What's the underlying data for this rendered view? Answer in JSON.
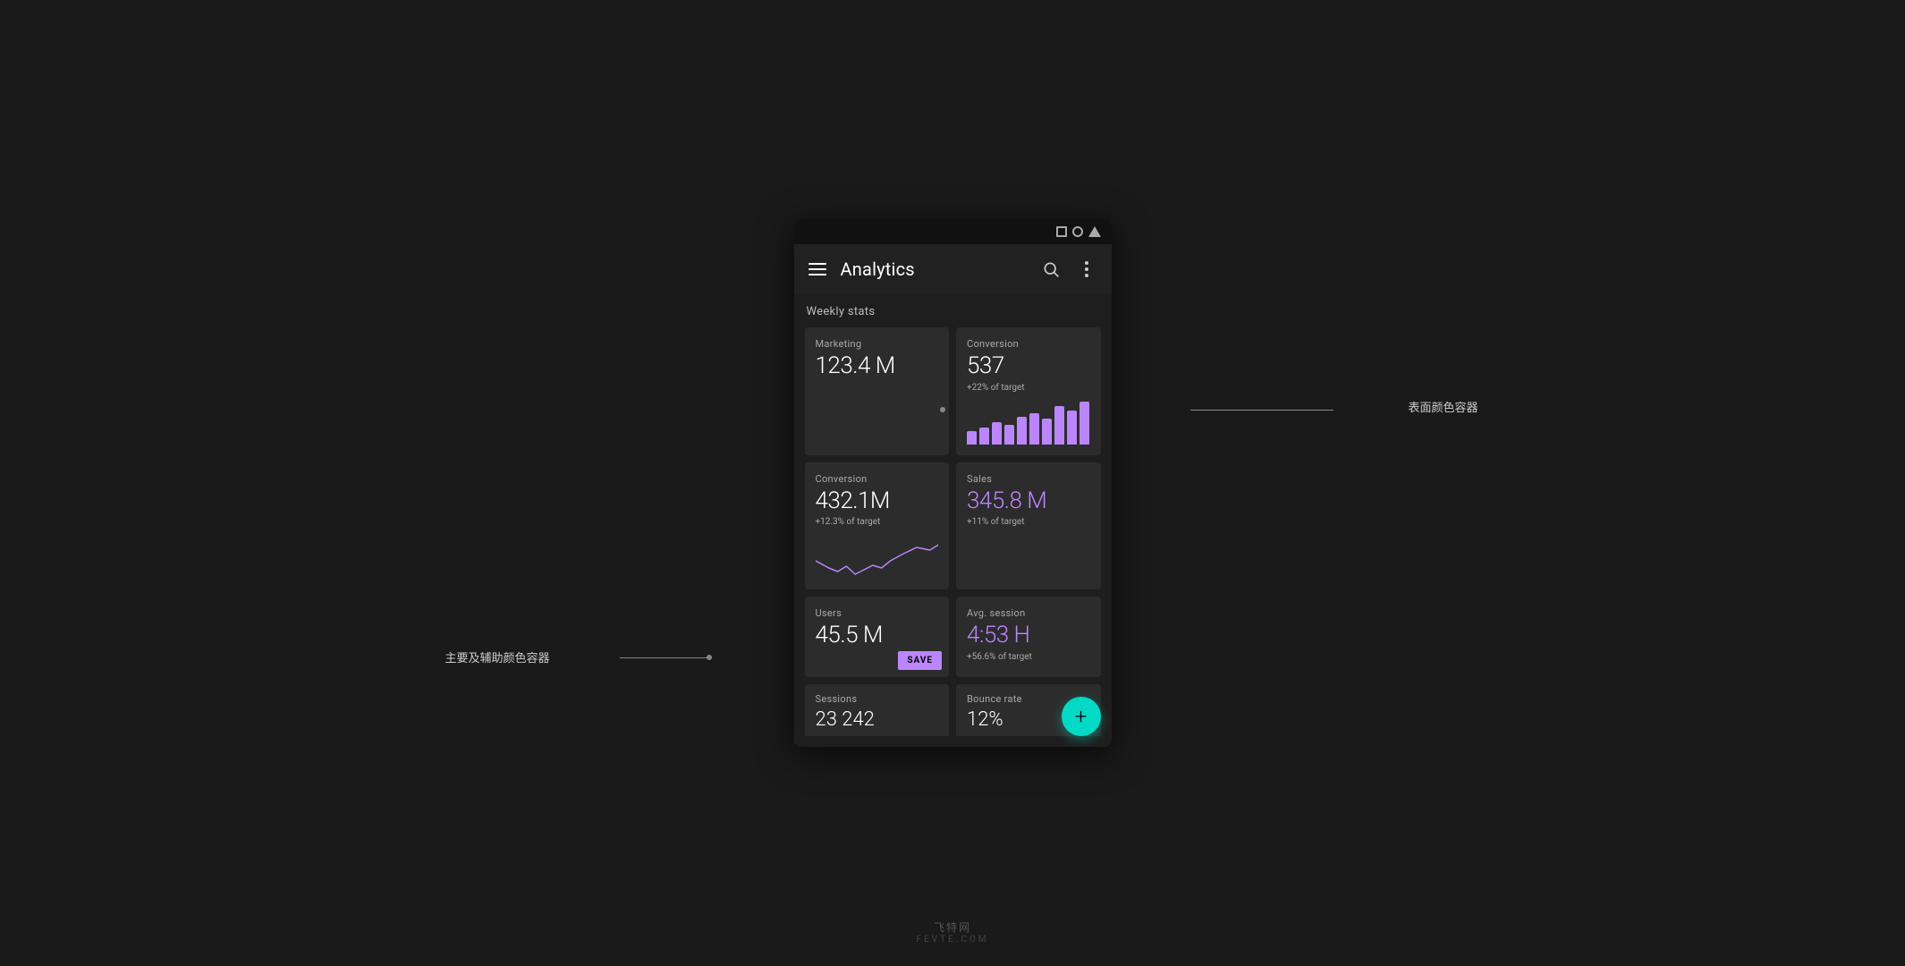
{
  "page": {
    "bg_color": "#1a1a1a"
  },
  "annotations": {
    "surface_label": "表面颜色容器",
    "primary_label": "主要及辅助颜色容器"
  },
  "app_bar": {
    "title": "Analytics",
    "search_label": "search",
    "more_label": "more options"
  },
  "weekly_stats": {
    "section_title": "Weekly stats",
    "cards": [
      {
        "id": "marketing",
        "label": "Marketing",
        "value": "123.4 M",
        "target": null,
        "chart": null,
        "purple": false
      },
      {
        "id": "conversion-top",
        "label": "Conversion",
        "value": "537",
        "target": "+22% of target",
        "chart": "bar",
        "purple": false,
        "bars": [
          25,
          30,
          45,
          35,
          55,
          60,
          50,
          70,
          65,
          80
        ]
      },
      {
        "id": "conversion-bottom",
        "label": "Conversion",
        "value": "432.1M",
        "target": "+12.3% of target",
        "chart": "line",
        "purple": false
      },
      {
        "id": "sales",
        "label": "Sales",
        "value": "345.8 M",
        "target": "+11% of target",
        "chart": null,
        "purple": true
      },
      {
        "id": "users",
        "label": "Users",
        "value": "45.5 M",
        "target": null,
        "chart": null,
        "purple": false,
        "has_save": true
      },
      {
        "id": "avg-session",
        "label": "Avg. session",
        "value": "4:53 H",
        "target": "+56.6% of target",
        "chart": null,
        "purple": true
      }
    ],
    "bottom_cards": [
      {
        "id": "sessions",
        "label": "Sessions",
        "value": "23 242"
      },
      {
        "id": "bounce-rate",
        "label": "Bounce rate",
        "value": "12%"
      }
    ]
  },
  "save_button": {
    "label": "SAVE"
  },
  "fab": {
    "label": "+"
  },
  "watermark": {
    "logo": "飞特网",
    "sub": "FEVTE.COM"
  }
}
